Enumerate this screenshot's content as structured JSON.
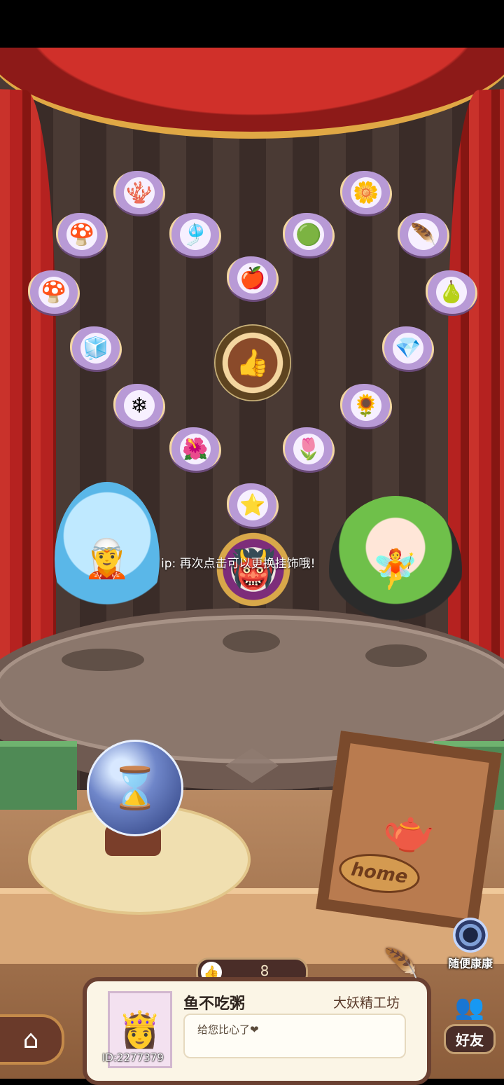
{
  "tip": "ip: 再次点击可以更换挂饰哦!",
  "items": [
    {
      "name": "coral",
      "icon": "🪸"
    },
    {
      "name": "blue-flower",
      "icon": "🌼"
    },
    {
      "name": "mushrooms",
      "icon": "🍄"
    },
    {
      "name": "jellyfish",
      "icon": "🎐"
    },
    {
      "name": "jade-ring",
      "icon": "🟢"
    },
    {
      "name": "rainbow-feather",
      "icon": "🪶"
    },
    {
      "name": "berry",
      "icon": "🍎"
    },
    {
      "name": "blue-mushroom",
      "icon": "🍄"
    },
    {
      "name": "teal-gourd",
      "icon": "🍐"
    },
    {
      "name": "ice-crystal",
      "icon": "🧊"
    },
    {
      "name": "white-crystal",
      "icon": "💎"
    },
    {
      "name": "ice-shard",
      "icon": "❄"
    },
    {
      "name": "golden-flower",
      "icon": "🌻"
    },
    {
      "name": "purple-flower",
      "icon": "🌺"
    },
    {
      "name": "lily",
      "icon": "🌷"
    },
    {
      "name": "star",
      "icon": "⭐"
    }
  ],
  "center_icon": "👍",
  "characters": {
    "left": "🧝",
    "middle": "👹",
    "right": "🧚"
  },
  "hourglass_icon": "⌛",
  "home_frame": {
    "icon": "🫖",
    "label": "home"
  },
  "random_button": {
    "label": "随便康康"
  },
  "likes": {
    "icon": "👍",
    "count": "8"
  },
  "player": {
    "name": "鱼不吃粥",
    "workshop": "大妖精工坊",
    "message": "给您比心了❤",
    "id": "ID:2277379",
    "avatar_icon": "👸"
  },
  "feather_icon": "🪶",
  "home_button_icon": "⌂",
  "friends": {
    "icon": "👥",
    "label": "好友"
  }
}
